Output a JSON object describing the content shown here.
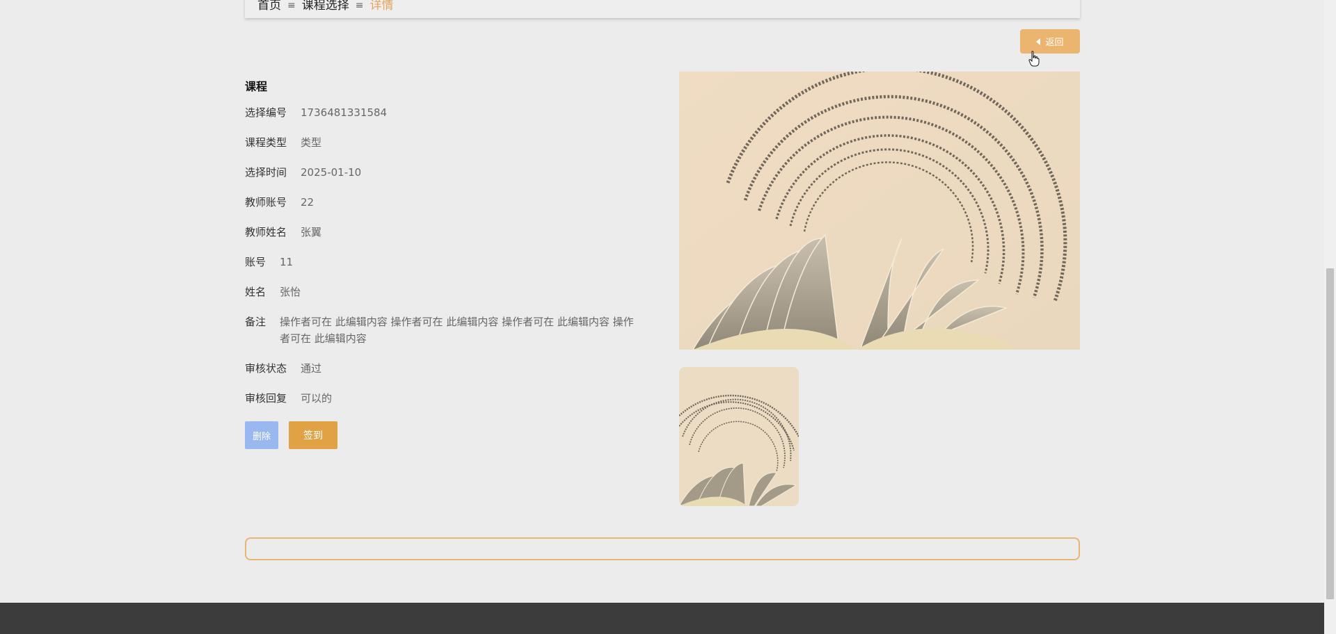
{
  "breadcrumb": {
    "home": "首页",
    "separator": "≡",
    "list": "课程选择",
    "current": "详情"
  },
  "back_button": {
    "label": "返回",
    "icon": "caret-left-icon"
  },
  "detail": {
    "heading": "课程",
    "fields": [
      {
        "label": "选择编号",
        "value": "1736481331584"
      },
      {
        "label": "课程类型",
        "value": "类型"
      },
      {
        "label": "选择时间",
        "value": "2025-01-10"
      },
      {
        "label": "教师账号",
        "value": "22"
      },
      {
        "label": "教师姓名",
        "value": "张翼"
      },
      {
        "label": "账号",
        "value": "11"
      },
      {
        "label": "姓名",
        "value": "张怡"
      },
      {
        "label": "备注",
        "value": "操作者可在 此编辑内容 操作者可在 此编辑内容 操作者可在 此编辑内容 操作者可在 此编辑内容"
      },
      {
        "label": "审核状态",
        "value": "通过"
      },
      {
        "label": "审核回复",
        "value": "可以的"
      }
    ]
  },
  "actions": {
    "delete_label": "删除",
    "signin_label": "签到"
  },
  "colors": {
    "accent": "#ebb46f",
    "breadcrumb_current": "#e6a55d",
    "delete_button": "#9ab8f0",
    "signin_button": "#e0a244",
    "footer": "#3c3c3c",
    "page_bg": "#ececec"
  }
}
